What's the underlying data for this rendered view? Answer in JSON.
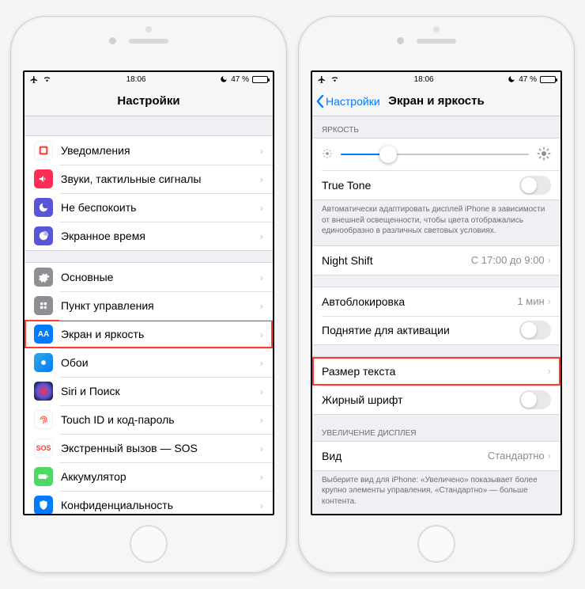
{
  "status": {
    "time": "18:06",
    "battery_pct": "47 %"
  },
  "left": {
    "title": "Настройки",
    "groups": [
      {
        "items": [
          {
            "icon": "notifications",
            "label": "Уведомления"
          },
          {
            "icon": "sounds",
            "label": "Звуки, тактильные сигналы"
          },
          {
            "icon": "dnd",
            "label": "Не беспокоить"
          },
          {
            "icon": "screentime",
            "label": "Экранное время"
          }
        ]
      },
      {
        "items": [
          {
            "icon": "general",
            "label": "Основные"
          },
          {
            "icon": "control",
            "label": "Пункт управления"
          },
          {
            "icon": "display",
            "label": "Экран и яркость",
            "highlight": true
          },
          {
            "icon": "wallpaper",
            "label": "Обои"
          },
          {
            "icon": "siri",
            "label": "Siri и Поиск"
          },
          {
            "icon": "touchid",
            "label": "Touch ID и код-пароль"
          },
          {
            "icon": "sos",
            "label": "Экстренный вызов — SOS"
          },
          {
            "icon": "battery",
            "label": "Аккумулятор"
          },
          {
            "icon": "privacy",
            "label": "Конфиденциальность"
          }
        ]
      }
    ]
  },
  "right": {
    "back": "Настройки",
    "title": "Экран и яркость",
    "brightness_header": "ЯРКОСТЬ",
    "truetone": {
      "label": "True Tone"
    },
    "truetone_footer": "Автоматически адаптировать дисплей iPhone в зависимости от внешней освещенности, чтобы цвета отображались единообразно в различных световых условиях.",
    "nightshift": {
      "label": "Night Shift",
      "detail": "С 17:00 до 9:00"
    },
    "autolock": {
      "label": "Автоблокировка",
      "detail": "1 мин"
    },
    "raise": {
      "label": "Поднятие для активации"
    },
    "textsize": {
      "label": "Размер текста"
    },
    "bold": {
      "label": "Жирный шрифт"
    },
    "zoom_header": "УВЕЛИЧЕНИЕ ДИСПЛЕЯ",
    "view": {
      "label": "Вид",
      "detail": "Стандартно"
    },
    "zoom_footer": "Выберите вид для iPhone: «Увеличено» показывает более крупно элементы управления, «Стандартно» — больше контента."
  }
}
